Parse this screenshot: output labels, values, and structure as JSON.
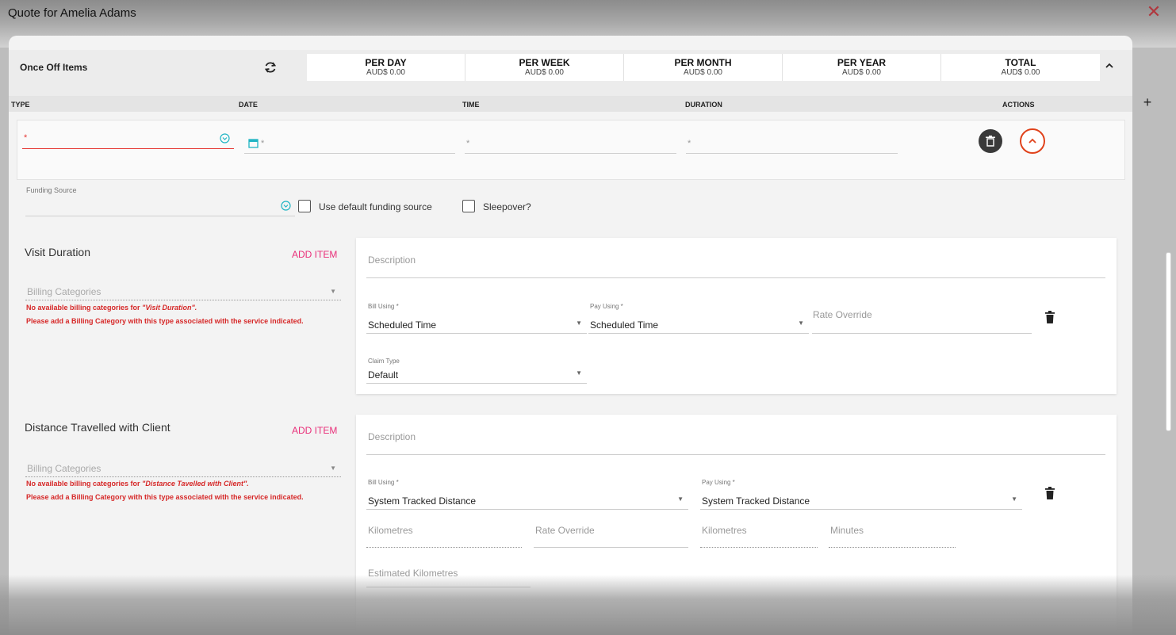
{
  "window": {
    "title": "Quote for Amelia Adams"
  },
  "summary": {
    "label": "Once Off Items",
    "stats": [
      {
        "label": "PER DAY",
        "value": "AUD$ 0.00"
      },
      {
        "label": "PER WEEK",
        "value": "AUD$ 0.00"
      },
      {
        "label": "PER MONTH",
        "value": "AUD$ 0.00"
      },
      {
        "label": "PER YEAR",
        "value": "AUD$ 0.00"
      },
      {
        "label": "TOTAL",
        "value": "AUD$ 0.00"
      }
    ]
  },
  "columns": [
    "TYPE",
    "DATE",
    "TIME",
    "DURATION",
    "ACTIONS"
  ],
  "row": {
    "required_marker": "*",
    "funding_source_label": "Funding Source",
    "use_default_label": "Use default funding source",
    "sleepover_label": "Sleepover?"
  },
  "sections": [
    {
      "title": "Visit Duration",
      "add_item": "ADD ITEM",
      "billing_placeholder": "Billing Categories",
      "error_line1_prefix": "No available billing categories for ",
      "error_line1_name": "\"Visit Duration\".",
      "error_line2": "Please add a Billing Category with this type associated with the service indicated.",
      "description_placeholder": "Description",
      "bill_using_label": "Bill Using *",
      "bill_using_value": "Scheduled Time",
      "pay_using_label": "Pay Using *",
      "pay_using_value": "Scheduled Time",
      "rate_override_placeholder": "Rate Override",
      "claim_type_label": "Claim Type",
      "claim_type_value": "Default"
    },
    {
      "title": "Distance Travelled with Client",
      "add_item": "ADD ITEM",
      "billing_placeholder": "Billing Categories",
      "error_line1_prefix": "No available billing categories for ",
      "error_line1_name": "\"Distance Tavelled with Client\".",
      "error_line2": "Please add a Billing Category with this type associated with the service indicated.",
      "description_placeholder": "Description",
      "bill_using_label": "Bill Using *",
      "bill_using_value": "System Tracked Distance",
      "pay_using_label": "Pay Using *",
      "pay_using_value": "System Tracked Distance",
      "kilometres_placeholder": "Kilometres",
      "rate_override_placeholder": "Rate Override",
      "pay_kilometres_placeholder": "Kilometres",
      "minutes_placeholder": "Minutes",
      "estimated_km_placeholder": "Estimated Kilometres"
    }
  ],
  "colors": {
    "accent_pink": "#e9307a",
    "error_red": "#d62828",
    "collapse_orange": "#e0421b",
    "info_teal": "#21b5c4"
  }
}
